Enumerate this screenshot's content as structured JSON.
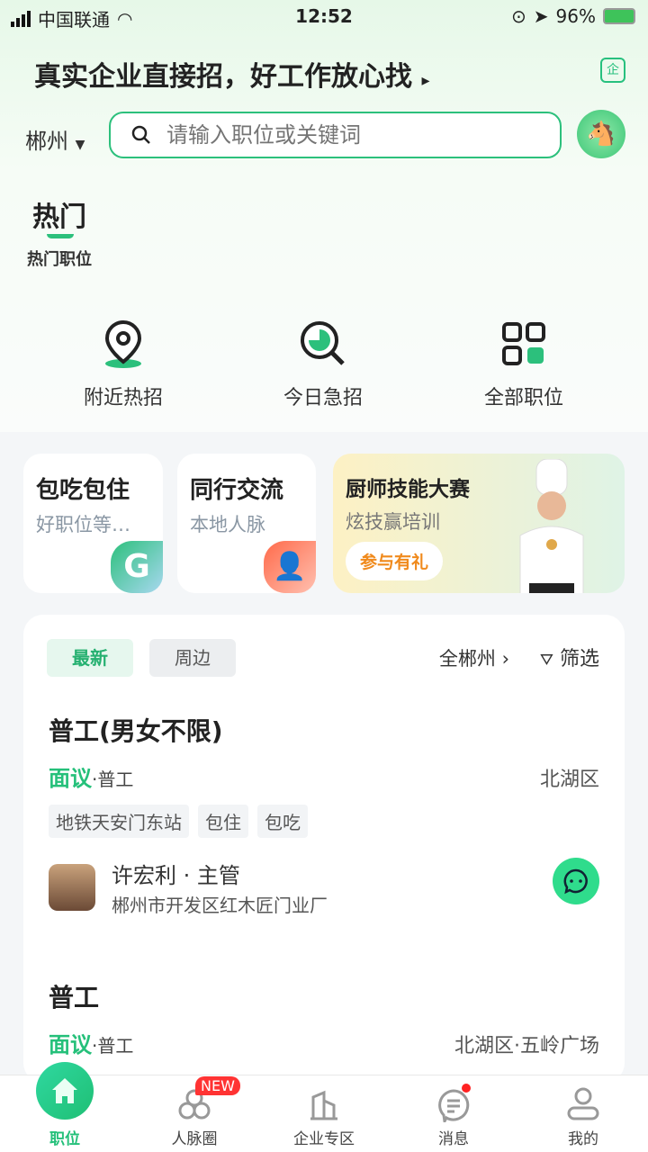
{
  "status": {
    "carrier": "中国联通",
    "time": "12:52",
    "battery": "96%"
  },
  "header": {
    "headline": "真实企业直接招，好工作放心找",
    "enterprise_badge": "企",
    "city": "郴州",
    "search_placeholder": "请输入职位或关键词"
  },
  "tabs": {
    "hot": "热门",
    "hot_sub": "热门职位"
  },
  "quick": [
    {
      "label": "附近热招",
      "icon": "location-pin-icon"
    },
    {
      "label": "今日急招",
      "icon": "search-clock-icon"
    },
    {
      "label": "全部职位",
      "icon": "grid-icon"
    }
  ],
  "cards": [
    {
      "title": "包吃包住",
      "subtitle": "好职位等…"
    },
    {
      "title": "同行交流",
      "subtitle": "本地人脉"
    }
  ],
  "promo": {
    "title": "厨师技能大赛",
    "subtitle": "炫技赢培训",
    "button": "参与有礼"
  },
  "list": {
    "chips": [
      "最新",
      "周边"
    ],
    "area": "全郴州",
    "filter": "筛选",
    "jobs": [
      {
        "title": "普工(男女不限)",
        "salary": "面议",
        "category": "·普工",
        "location": "北湖区",
        "tags": [
          "地铁天安门东站",
          "包住",
          "包吃"
        ],
        "recruiter": "许宏利 · 主管",
        "company": "郴州市开发区红木匠门业厂"
      },
      {
        "title": "普工",
        "salary": "面议",
        "category": "·普工",
        "location": "北湖区·五岭广场"
      }
    ]
  },
  "nav": [
    {
      "label": "职位",
      "icon": "home-icon"
    },
    {
      "label": "人脉圈",
      "icon": "circles-icon",
      "badge": "NEW"
    },
    {
      "label": "企业专区",
      "icon": "building-icon"
    },
    {
      "label": "消息",
      "icon": "message-icon"
    },
    {
      "label": "我的",
      "icon": "user-icon"
    }
  ],
  "colors": {
    "accent": "#2cc07c",
    "salary": "#25c07a",
    "badge": "#ff3333"
  }
}
